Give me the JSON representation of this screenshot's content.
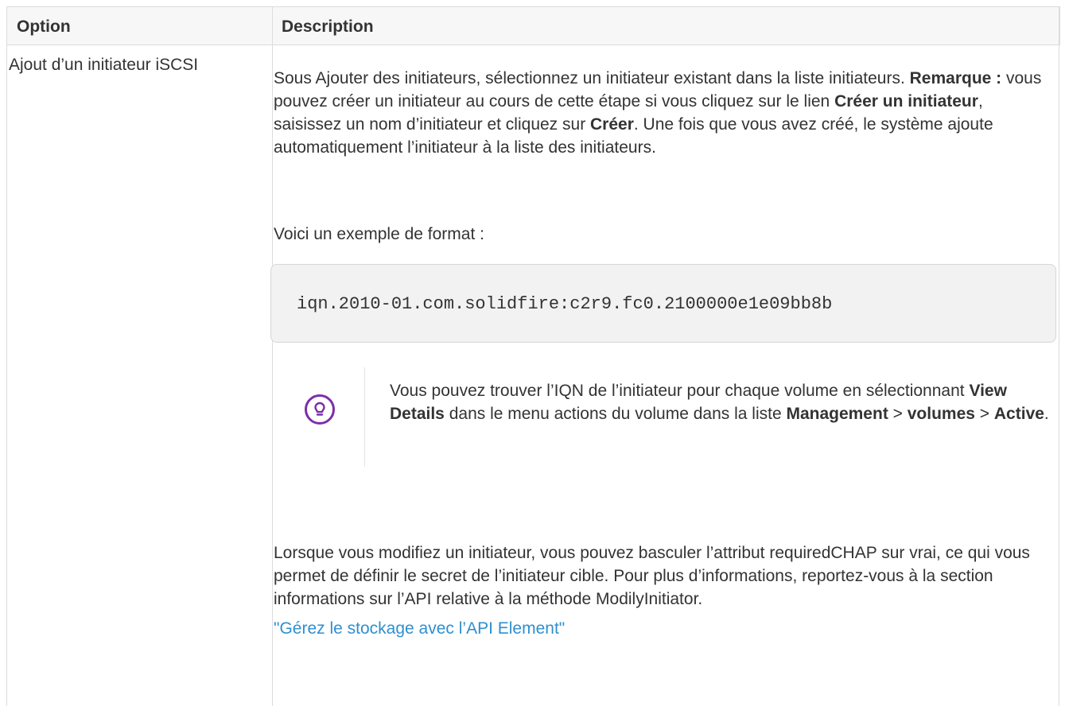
{
  "table": {
    "headers": [
      "Option",
      "Description"
    ],
    "option": "Ajout d’un initiateur iSCSI"
  },
  "description": {
    "p1": {
      "t1": "Sous Ajouter des initiateurs, sélectionnez un initiateur existant dans la liste initiateurs. ",
      "b1": "Remarque :",
      "t2": " vous pouvez créer un initiateur au cours de cette étape si vous cliquez sur le lien ",
      "b2": "Créer un initiateur",
      "t3": ", saisissez un nom d’initiateur et cliquez sur ",
      "b3": "Créer",
      "t4": ". Une fois que vous avez créé, le système ajoute automatiquement l’initiateur à la liste des initiateurs."
    },
    "p2": "Voici un exemple de format :",
    "code": "iqn.2010-01.com.solidfire:c2r9.fc0.2100000e1e09bb8b",
    "tip": {
      "icon": "lightbulb-icon",
      "t1": "Vous pouvez trouver l’IQN de l’initiateur pour chaque volume en sélectionnant ",
      "b1": "View Details",
      "t2": " dans le menu actions du volume dans la liste ",
      "b2": "Management",
      "t3": " > ",
      "b3": "volumes",
      "t4": " > ",
      "b4": "Active",
      "t5": "."
    },
    "p3": "Lorsque vous modifiez un initiateur, vous pouvez basculer l’attribut requiredCHAP sur vrai, ce qui vous permet de définir le secret de l’initiateur cible. Pour plus d’informations, reportez-vous à la section informations sur l’API relative à la méthode ModilyInitiator.",
    "link": "\"Gérez le stockage avec l’API Element\""
  },
  "colors": {
    "link": "#2f8fd0",
    "tip_icon": "#7b2fa8",
    "header_bg": "#f7f7f8"
  }
}
